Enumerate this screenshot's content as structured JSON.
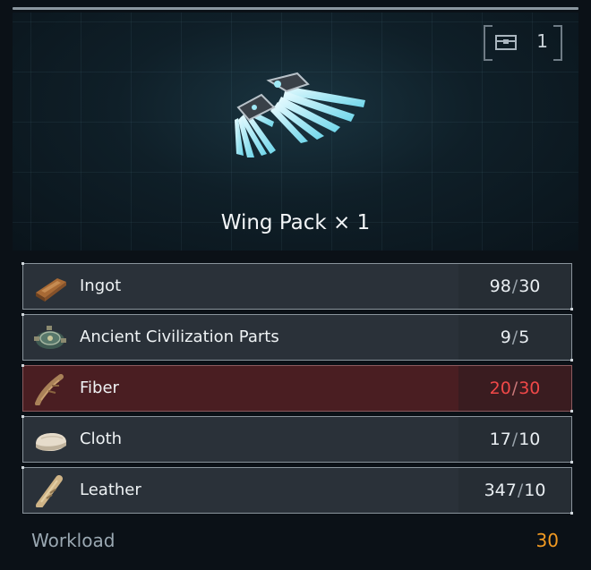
{
  "item": {
    "name": "Wing Pack × 1",
    "icon": "wing-pack-icon",
    "stack_count": "1"
  },
  "materials": [
    {
      "name": "Ingot",
      "have": "98",
      "need": "30",
      "icon": "ingot-icon",
      "sufficient": true
    },
    {
      "name": "Ancient Civilization Parts",
      "have": "9",
      "need": "5",
      "icon": "ancient-parts-icon",
      "sufficient": true
    },
    {
      "name": "Fiber",
      "have": "20",
      "need": "30",
      "icon": "fiber-icon",
      "sufficient": false
    },
    {
      "name": "Cloth",
      "have": "17",
      "need": "10",
      "icon": "cloth-icon",
      "sufficient": true
    },
    {
      "name": "Leather",
      "have": "347",
      "need": "10",
      "icon": "leather-icon",
      "sufficient": true
    }
  ],
  "workload": {
    "label": "Workload",
    "value": "30"
  },
  "colors": {
    "insufficient": "#f04848",
    "workload_value": "#f29a22",
    "wing_glow": "#9fe8f5"
  }
}
